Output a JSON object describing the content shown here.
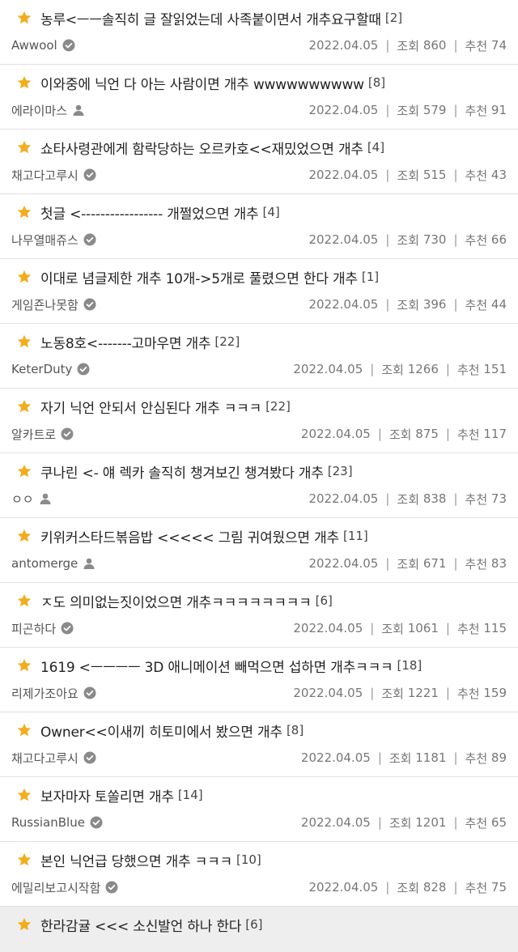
{
  "posts": [
    {
      "title": "농루<ㅡㅡ솔직히 글 잘읽었는데 사족붙이면서 개추요구할때",
      "count": "[2]",
      "author": "Awwool",
      "author_icon": "check",
      "date": "2022.04.05",
      "views_label": "조회",
      "views": "860",
      "likes_label": "추천",
      "likes": "74"
    },
    {
      "title": "이와중에 닉언 다 아는 사람이면 개추 wwwwwwwwww",
      "count": "[8]",
      "author": "에라이마스",
      "author_icon": "person",
      "date": "2022.04.05",
      "views_label": "조회",
      "views": "579",
      "likes_label": "추천",
      "likes": "91"
    },
    {
      "title": "쇼타사령관에게 함락당하는 오르카호<<재밌었으면 개추",
      "count": "[4]",
      "author": "채고다고루시",
      "author_icon": "check",
      "date": "2022.04.05",
      "views_label": "조회",
      "views": "515",
      "likes_label": "추천",
      "likes": "43"
    },
    {
      "title": "첫글 <----------------- 개쩔었으면 개추",
      "count": "[4]",
      "author": "나무열매쥬스",
      "author_icon": "check",
      "date": "2022.04.05",
      "views_label": "조회",
      "views": "730",
      "likes_label": "추천",
      "likes": "66"
    },
    {
      "title": "이대로 념글제한 개추 10개->5개로 풀렸으면 한다 개추",
      "count": "[1]",
      "author": "게임죤나못함",
      "author_icon": "check",
      "date": "2022.04.05",
      "views_label": "조회",
      "views": "396",
      "likes_label": "추천",
      "likes": "44"
    },
    {
      "title": "노동8호<-------고마우면 개추",
      "count": "[22]",
      "author": "KeterDuty",
      "author_icon": "check",
      "date": "2022.04.05",
      "views_label": "조회",
      "views": "1266",
      "likes_label": "추천",
      "likes": "151"
    },
    {
      "title": "자기 닉언 안되서 안심된다 개추 ㅋㅋㅋ",
      "count": "[22]",
      "author": "알카트로",
      "author_icon": "check",
      "date": "2022.04.05",
      "views_label": "조회",
      "views": "875",
      "likes_label": "추천",
      "likes": "117"
    },
    {
      "title": "쿠나린 <- 얘 렉카 솔직히 챙겨보긴 챙겨봤다 개추",
      "count": "[23]",
      "author": "ㅇㅇ",
      "author_icon": "person",
      "date": "2022.04.05",
      "views_label": "조회",
      "views": "838",
      "likes_label": "추천",
      "likes": "73"
    },
    {
      "title": "키위커스타드볶음밥 <<<<< 그림 귀여웠으면 개추",
      "count": "[11]",
      "author": "antomerge",
      "author_icon": "person",
      "date": "2022.04.05",
      "views_label": "조회",
      "views": "671",
      "likes_label": "추천",
      "likes": "83"
    },
    {
      "title": "ㅈ도 의미없는짓이었으면 개추ㅋㅋㅋㅋㅋㅋㅋㅋ",
      "count": "[6]",
      "author": "피곤하다",
      "author_icon": "check",
      "date": "2022.04.05",
      "views_label": "조회",
      "views": "1061",
      "likes_label": "추천",
      "likes": "115"
    },
    {
      "title": "1619 <ㅡㅡㅡㅡ 3D 애니메이션 빼먹으면 섭하면 개추ㅋㅋㅋ",
      "count": "[18]",
      "author": "리제가조아요",
      "author_icon": "check",
      "date": "2022.04.05",
      "views_label": "조회",
      "views": "1221",
      "likes_label": "추천",
      "likes": "159"
    },
    {
      "title": "Owner<<이새끼 히토미에서 봤으면 개추",
      "count": "[8]",
      "author": "채고다고루시",
      "author_icon": "check",
      "date": "2022.04.05",
      "views_label": "조회",
      "views": "1181",
      "likes_label": "추천",
      "likes": "89"
    },
    {
      "title": "보자마자 토쏠리면 개추",
      "count": "[14]",
      "author": "RussianBlue",
      "author_icon": "check",
      "date": "2022.04.05",
      "views_label": "조회",
      "views": "1201",
      "likes_label": "추천",
      "likes": "65"
    },
    {
      "title": "본인 닉언급 당했으면 개추 ㅋㅋㅋ",
      "count": "[10]",
      "author": "에밀리보고시작함",
      "author_icon": "check",
      "date": "2022.04.05",
      "views_label": "조회",
      "views": "828",
      "likes_label": "추천",
      "likes": "75"
    },
    {
      "title": "한라감귤 <<< 소신발언 하나 한다",
      "count": "[6]",
      "highlight": true
    }
  ],
  "colors": {
    "star": "#f2ad1c",
    "icon": "#8a8a8a"
  }
}
